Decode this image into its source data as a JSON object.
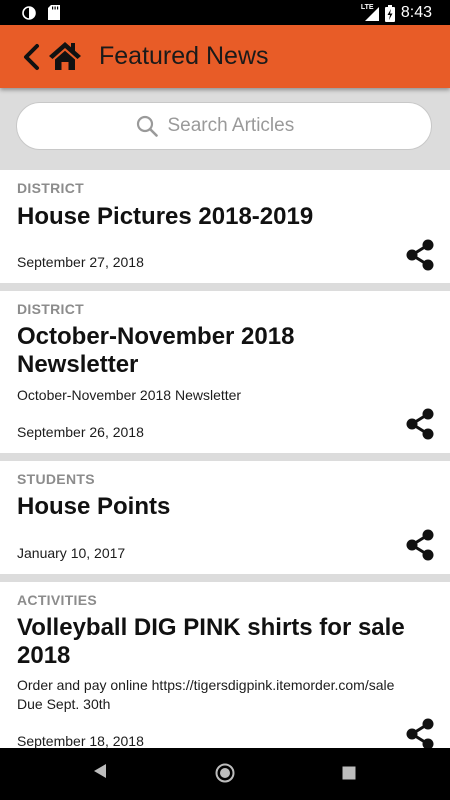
{
  "status_bar": {
    "time": "8:43",
    "network_label": "LTE"
  },
  "app_bar": {
    "title": "Featured News"
  },
  "search": {
    "placeholder": "Search Articles"
  },
  "articles": [
    {
      "category": "DISTRICT",
      "title": "House Pictures 2018-2019",
      "summary": "",
      "date": "September 27, 2018"
    },
    {
      "category": "DISTRICT",
      "title": "October-November 2018 Newsletter",
      "summary": "October-November 2018 Newsletter",
      "date": "September 26, 2018"
    },
    {
      "category": "STUDENTS",
      "title": "House Points",
      "summary": "",
      "date": "January 10, 2017"
    },
    {
      "category": "ACTIVITIES",
      "title": "Volleyball DIG PINK shirts for sale 2018",
      "summary": "Order and pay online https://tigersdigpink.itemorder.com/sale Due Sept. 30th",
      "date": "September 18, 2018"
    }
  ],
  "colors": {
    "accent": "#e85c27",
    "background": "#dcdcdc",
    "category_text": "#8c8c8c"
  },
  "icons": {
    "back": "chevron-left-icon",
    "home": "home-icon",
    "search": "search-icon",
    "share": "share-icon",
    "nav_back": "triangle-back-icon",
    "nav_home": "circle-home-icon",
    "nav_recents": "square-recents-icon"
  }
}
